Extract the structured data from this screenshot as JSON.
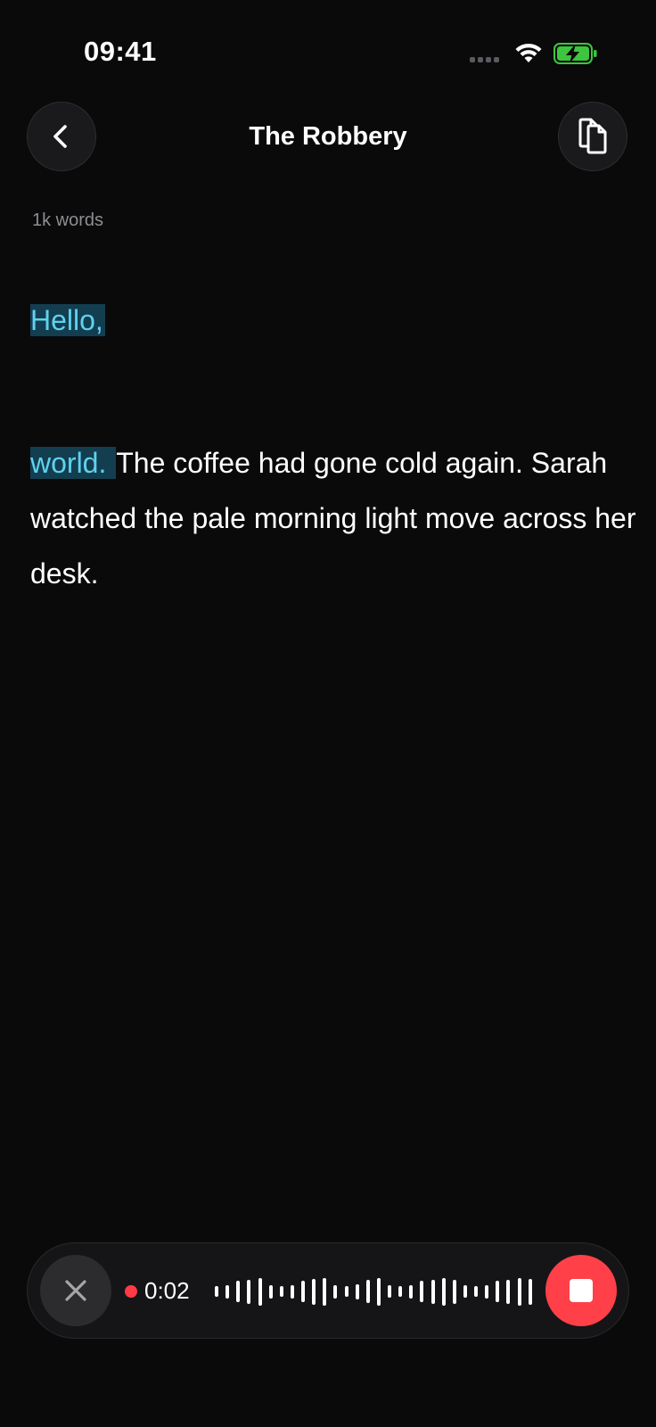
{
  "status_bar": {
    "time": "09:41",
    "battery_color": "#3ec53f"
  },
  "header": {
    "title": "The Robbery",
    "back_icon": "chevron-left-icon",
    "copy_icon": "copy-icon"
  },
  "document": {
    "word_count": "1k words",
    "paragraphs": [
      {
        "highlighted": "Hello,",
        "rest": ""
      },
      {
        "highlighted": "world. ",
        "rest": "The coffee had gone cold again. Sarah watched the pale morning light move across her desk."
      }
    ],
    "highlight_color": "#133e50",
    "highlight_text_color": "#5fd1ee"
  },
  "recorder": {
    "elapsed": "0:02",
    "cancel_icon": "close-icon",
    "stop_icon": "stop-icon",
    "stop_color": "#ff4048",
    "recording_dot_color": "#ff3b45",
    "waveform_levels": [
      0.35,
      0.45,
      0.7,
      0.8,
      0.9,
      0.45,
      0.35,
      0.45,
      0.7,
      0.85,
      0.9,
      0.45,
      0.35,
      0.5,
      0.75,
      0.9,
      0.4,
      0.35,
      0.45,
      0.7,
      0.8,
      0.9,
      0.8,
      0.4,
      0.35,
      0.45,
      0.7,
      0.8,
      0.9,
      0.85
    ]
  }
}
